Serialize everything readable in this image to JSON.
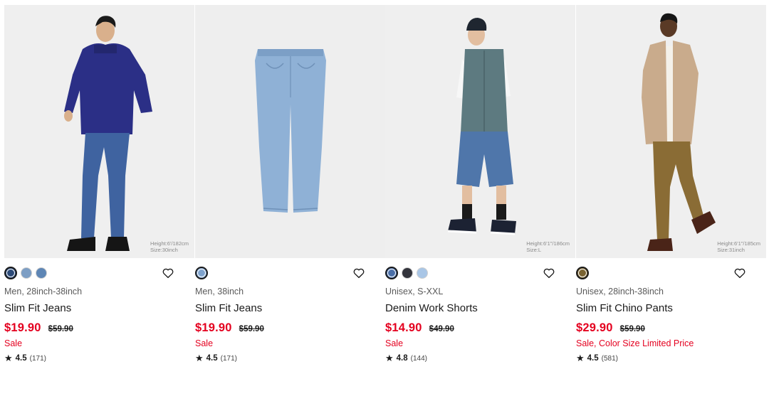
{
  "products": [
    {
      "photo_note": [
        "Height:6'/182cm",
        "Size:30inch"
      ],
      "swatches": [
        "#2c4a78",
        "#7d9ec4",
        "#5e86b5"
      ],
      "meta": "Men, 28inch-38inch",
      "name": "Slim Fit Jeans",
      "price": "$19.90",
      "original_price": "$59.90",
      "promo": "Sale",
      "rating_star": "★",
      "rating": "4.5",
      "reviews": "(171)"
    },
    {
      "photo_note": [],
      "swatches": [
        "#7fa3cd"
      ],
      "meta": "Men, 38inch",
      "name": "Slim Fit Jeans",
      "price": "$19.90",
      "original_price": "$59.90",
      "promo": "Sale",
      "rating_star": "★",
      "rating": "4.5",
      "reviews": "(171)"
    },
    {
      "photo_note": [
        "Height:6'1\"/186cm",
        "Size:L"
      ],
      "swatches": [
        "#4a6fa8",
        "#33343c",
        "#a9c6e6"
      ],
      "meta": "Unisex, S-XXL",
      "name": "Denim Work Shorts",
      "price": "$14.90",
      "original_price": "$49.90",
      "promo": "Sale",
      "rating_star": "★",
      "rating": "4.8",
      "reviews": "(144)"
    },
    {
      "photo_note": [
        "Height:6'1\"/185cm",
        "Size:31inch"
      ],
      "swatches": [
        "#7a6331"
      ],
      "meta": "Unisex, 28inch-38inch",
      "name": "Slim Fit Chino Pants",
      "price": "$29.90",
      "original_price": "$59.90",
      "promo": "Sale, Color Size Limited Price",
      "rating_star": "★",
      "rating": "4.5",
      "reviews": "(581)"
    }
  ],
  "icons": {
    "favorite": "heart-outline-icon",
    "rating": "star-icon"
  },
  "colors": {
    "sale_red": "#e4001f",
    "photo_bg": "#ededed"
  }
}
